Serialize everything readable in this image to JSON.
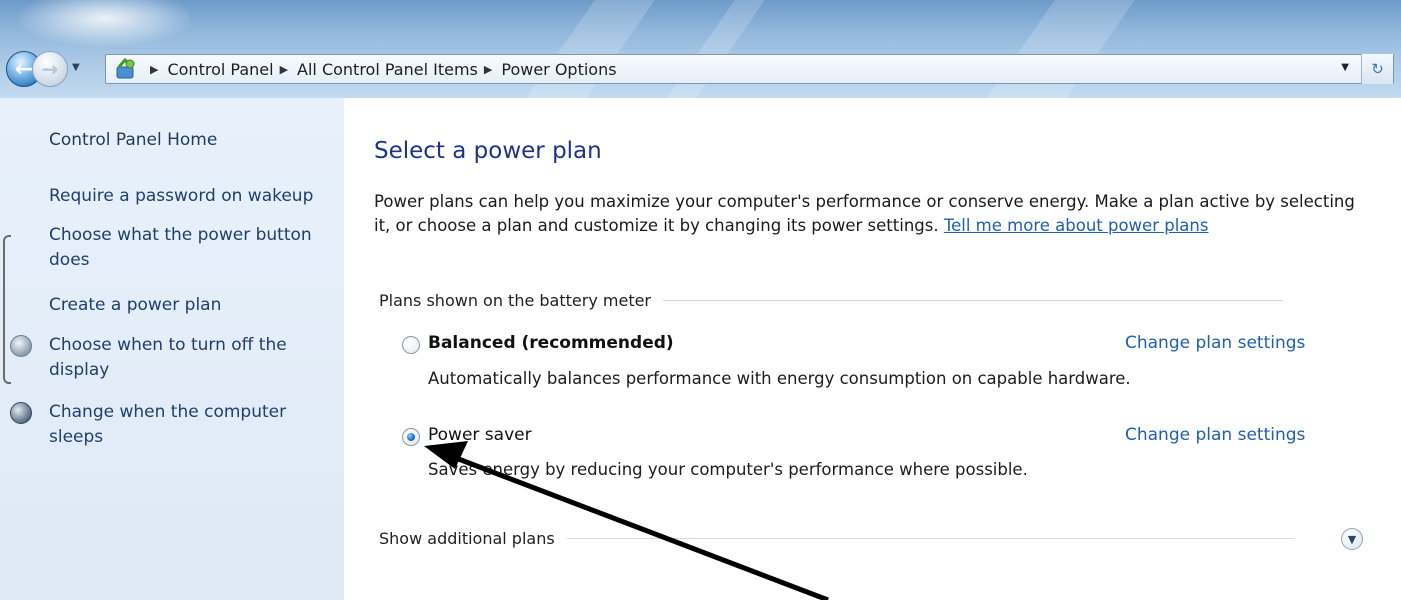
{
  "address_bar": {
    "breadcrumb": [
      "Control Panel",
      "All Control Panel Items",
      "Power Options"
    ]
  },
  "sidebar": {
    "home": "Control Panel Home",
    "links": [
      "Require a password on wakeup",
      "Choose what the power button does",
      "Create a power plan",
      "Choose when to turn off the display",
      "Change when the computer sleeps"
    ],
    "link_lines": {
      "power_button": [
        "Choose what the power button",
        "does"
      ],
      "display": [
        "Choose when to turn off the",
        "display"
      ],
      "sleep": [
        "Change when the computer",
        "sleeps"
      ]
    }
  },
  "main": {
    "heading": "Select a power plan",
    "description": "Power plans can help you maximize your computer's performance or conserve energy. Make a plan active by selecting it, or choose a plan and customize it by changing its power settings.",
    "description_link": "Tell me more about power plans",
    "section_label": "Plans shown on the battery meter",
    "plans": [
      {
        "name": "Balanced (recommended)",
        "description": "Automatically balances performance with energy consumption on capable hardware.",
        "selected": false,
        "change_link": "Change plan settings"
      },
      {
        "name": "Power saver",
        "description": "Saves energy by reducing your computer's performance where possible.",
        "selected": true,
        "change_link": "Change plan settings"
      }
    ],
    "additional_label": "Show additional plans"
  },
  "colors": {
    "link": "#1e5fb1",
    "heading": "#1e3287",
    "sidebar_bg": "#e3edf8",
    "annotation_arrow": "#000000"
  },
  "icons": [
    "back-arrow-icon",
    "forward-arrow-icon",
    "control-panel-icon",
    "refresh-icon",
    "display-icon",
    "sleep-icon",
    "expand-chevron-icon"
  ]
}
